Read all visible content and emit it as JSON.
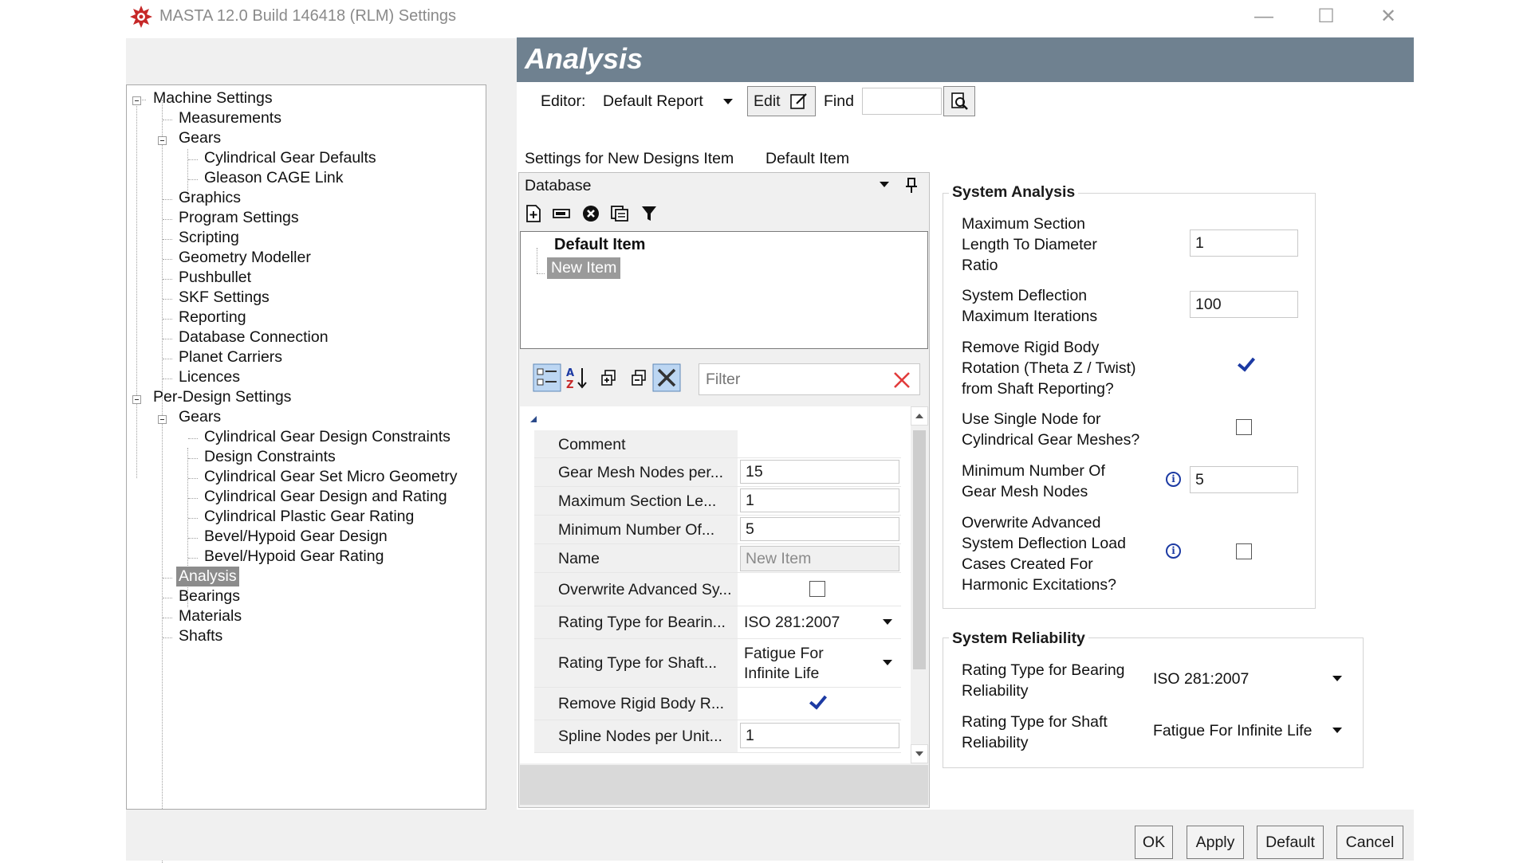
{
  "window": {
    "title": "MASTA 12.0 Build 146418 (RLM) Settings",
    "minimize": "—",
    "maximize": "☐",
    "close": "✕"
  },
  "tree": {
    "items": [
      {
        "label": "Machine Settings"
      },
      {
        "label": "Measurements"
      },
      {
        "label": "Gears"
      },
      {
        "label": "Cylindrical Gear Defaults"
      },
      {
        "label": "Gleason CAGE Link"
      },
      {
        "label": "Graphics"
      },
      {
        "label": "Program Settings"
      },
      {
        "label": "Scripting"
      },
      {
        "label": "Geometry Modeller"
      },
      {
        "label": "Pushbullet"
      },
      {
        "label": "SKF Settings"
      },
      {
        "label": "Reporting"
      },
      {
        "label": "Database Connection"
      },
      {
        "label": "Planet Carriers"
      },
      {
        "label": "Licences"
      },
      {
        "label": "Per-Design Settings"
      },
      {
        "label": "Gears"
      },
      {
        "label": "Cylindrical Gear Design Constraints"
      },
      {
        "label": "Design Constraints"
      },
      {
        "label": "Cylindrical Gear Set Micro Geometry"
      },
      {
        "label": "Cylindrical Gear Design and Rating"
      },
      {
        "label": "Cylindrical Plastic Gear Rating"
      },
      {
        "label": "Bevel/Hypoid Gear Design"
      },
      {
        "label": "Bevel/Hypoid Gear Rating"
      },
      {
        "label": "Analysis"
      },
      {
        "label": "Bearings"
      },
      {
        "label": "Materials"
      },
      {
        "label": "Shafts"
      }
    ]
  },
  "header": {
    "title": "Analysis"
  },
  "editor": {
    "label": "Editor:",
    "value": "Default Report",
    "edit": "Edit",
    "find": "Find",
    "find_value": ""
  },
  "settings_line": {
    "label": "Settings for New Designs Item",
    "value": "Default Item"
  },
  "database": {
    "title": "Database",
    "items": [
      "Default Item",
      "New Item"
    ]
  },
  "filter": {
    "placeholder": "Filter"
  },
  "properties": [
    {
      "name": "Comment",
      "value": ""
    },
    {
      "name": "Gear Mesh Nodes per...",
      "value": "15"
    },
    {
      "name": "Maximum Section Le...",
      "value": "1"
    },
    {
      "name": "Minimum Number Of...",
      "value": "5"
    },
    {
      "name": "Name",
      "value": "New Item"
    },
    {
      "name": "Overwrite Advanced Sy...",
      "value": ""
    },
    {
      "name": "Rating Type for Bearin...",
      "value": "ISO 281:2007"
    },
    {
      "name": "Rating Type for Shaft...",
      "value": "Fatigue For",
      "value2": "Infinite Life"
    },
    {
      "name": "Remove Rigid Body R...",
      "value": ""
    },
    {
      "name": "Spline Nodes per Unit...",
      "value": "1"
    }
  ],
  "system_analysis": {
    "title": "System Analysis",
    "max_section_label": [
      "Maximum Section",
      "Length To Diameter",
      "Ratio"
    ],
    "max_section_value": "1",
    "deflection_label": [
      "System Deflection",
      "Maximum Iterations"
    ],
    "deflection_value": "100",
    "remove_rigid_label": [
      "Remove Rigid Body",
      "Rotation (Theta Z / Twist)",
      "from Shaft Reporting?"
    ],
    "remove_rigid_checked": true,
    "single_node_label": [
      "Use Single Node for",
      "Cylindrical Gear Meshes?"
    ],
    "single_node_checked": false,
    "min_nodes_label": [
      "Minimum Number Of",
      "Gear Mesh Nodes"
    ],
    "min_nodes_value": "5",
    "overwrite_label": [
      "Overwrite Advanced",
      "System Deflection Load",
      "Cases Created For",
      "Harmonic Excitations?"
    ],
    "overwrite_checked": false
  },
  "system_reliability": {
    "title": "System Reliability",
    "bearing_label": [
      "Rating Type for Bearing",
      "Reliability"
    ],
    "bearing_value": "ISO 281:2007",
    "shaft_label": [
      "Rating Type for Shaft",
      "Reliability"
    ],
    "shaft_value": "Fatigue For Infinite Life"
  },
  "buttons": {
    "ok": "OK",
    "apply": "Apply",
    "default": "Default",
    "cancel": "Cancel"
  },
  "colors": {
    "header": "#6f8190",
    "check": "#1c3aa3",
    "selection": "#8c8c8c",
    "app_icon": "#c62828"
  }
}
